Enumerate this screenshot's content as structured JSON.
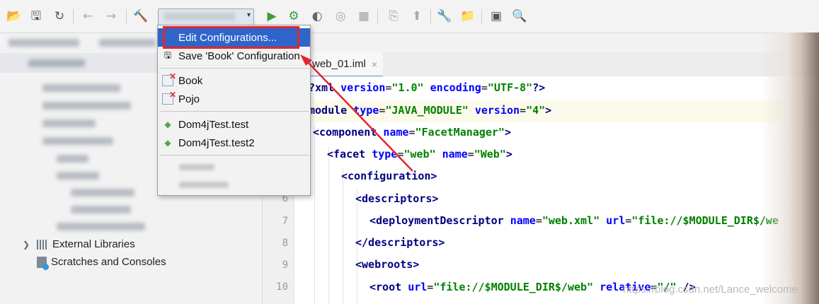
{
  "toolbar": {
    "icons": [
      "open-icon",
      "save-icon",
      "sync-icon",
      "back-icon",
      "forward-icon",
      "build-icon",
      "run-icon",
      "debug-icon",
      "coverage-icon",
      "profile-icon",
      "stop-icon",
      "vcs-icon",
      "vcs2-icon",
      "settings-icon",
      "project-structure-icon",
      "terminal-icon",
      "search-icon"
    ],
    "run_config_value": ""
  },
  "project_panel": {
    "tree_labels": {
      "external_libraries": "External Libraries",
      "scratches": "Scratches and Consoles"
    }
  },
  "editor": {
    "tab_label": "web_01.iml",
    "tab_close": "×",
    "line_numbers": [
      "6",
      "7",
      "8",
      "9",
      "10"
    ]
  },
  "run_menu": {
    "items": [
      {
        "label": "Edit Configurations...",
        "selected": true
      },
      {
        "label": "Save 'Book' Configuration"
      },
      {
        "label": "Book"
      },
      {
        "label": "Pojo"
      },
      {
        "label": "Dom4jTest.test"
      },
      {
        "label": "Dom4jTest.test2"
      }
    ]
  },
  "code": {
    "l1_open": "?",
    "l1_tag": "xml",
    "l1_a1": "version",
    "l1_v1": "\"1.0\"",
    "l1_a2": "encoding",
    "l1_v2": "\"UTF-8\"",
    "l1_close": "?>",
    "l2_tag": "module",
    "l2_a1": "type",
    "l2_v1": "\"JAVA_MODULE\"",
    "l2_a2": "version",
    "l2_v2": "\"4\"",
    "l2_close": ">",
    "l3_tag": "<component",
    "l3_a1": "name",
    "l3_v1": "\"FacetManager\"",
    "l3_close": ">",
    "l4_tag": "<facet",
    "l4_a1": "type",
    "l4_v1": "\"web\"",
    "l4_a2": "name",
    "l4_v2": "\"Web\"",
    "l4_close": ">",
    "l5": "<configuration>",
    "l6": "<descriptors>",
    "l7_tag": "<deploymentDescriptor",
    "l7_a1": "name",
    "l7_v1": "\"web.xml\"",
    "l7_a2": "url",
    "l7_v2": "\"file://$MODULE_DIR$/we",
    "l8": "</descriptors>",
    "l9": "<webroots>",
    "l10_tag": "<root",
    "l10_a1": "url",
    "l10_v1": "\"file://$MODULE_DIR$/web\"",
    "l10_a2": "relative",
    "l10_v2": "\"/\"",
    "l10_close": "/>"
  },
  "watermark": "https://blog.csdn.net/Lance_welcome",
  "colors": {
    "selection": "#2f65ca",
    "highlight_border": "#e2262c",
    "xml_tag": "#000080",
    "xml_attr": "#0000ff",
    "xml_value": "#008000"
  }
}
